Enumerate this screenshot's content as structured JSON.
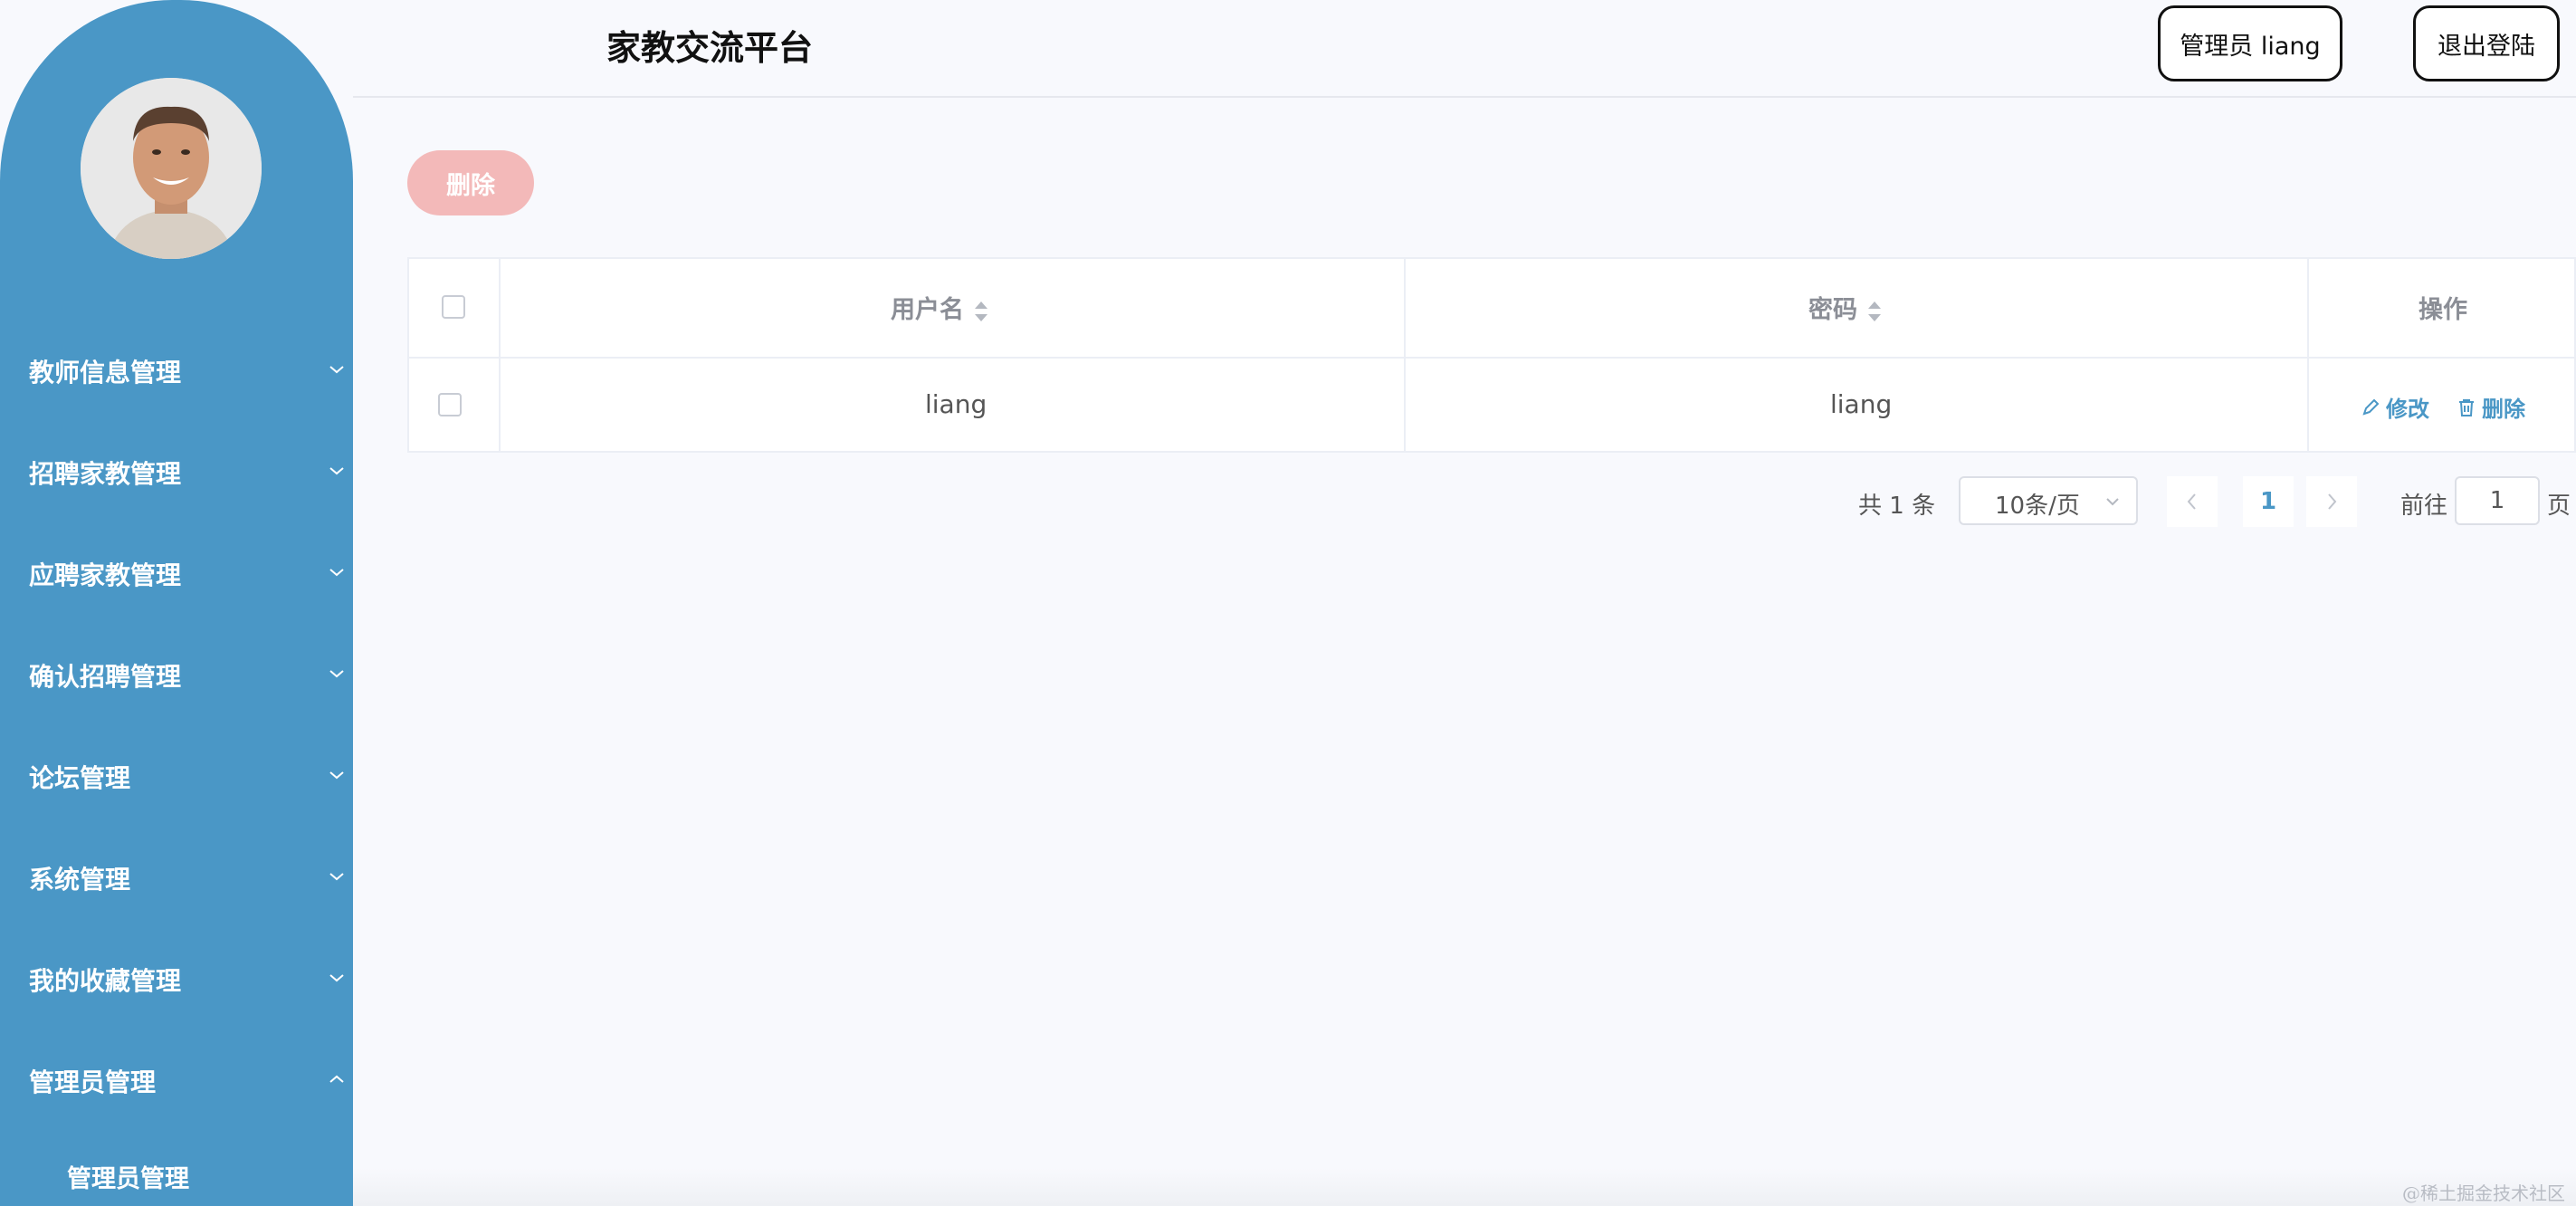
{
  "header": {
    "title": "家教交流平台",
    "admin_label": "管理员 liang",
    "logout_label": "退出登陆"
  },
  "sidebar": {
    "avatar": "avatar-photo",
    "items": [
      {
        "label": "教师信息管理",
        "expanded": false
      },
      {
        "label": "招聘家教管理",
        "expanded": false
      },
      {
        "label": "应聘家教管理",
        "expanded": false
      },
      {
        "label": "确认招聘管理",
        "expanded": false
      },
      {
        "label": "论坛管理",
        "expanded": false
      },
      {
        "label": "系统管理",
        "expanded": false
      },
      {
        "label": "我的收藏管理",
        "expanded": false
      },
      {
        "label": "管理员管理",
        "expanded": true
      }
    ],
    "subitems": [
      {
        "label": "管理员管理"
      }
    ]
  },
  "toolbar": {
    "delete_label": "删除"
  },
  "table": {
    "columns": [
      "用户名",
      "密码",
      "操作"
    ],
    "rows": [
      {
        "username": "liang",
        "password": "liang",
        "edit_label": "修改",
        "delete_label": "删除"
      }
    ]
  },
  "pagination": {
    "total": "共 1 条",
    "page_size": "10条/页",
    "current_page": "1",
    "goto_label": "前往",
    "goto_value": "1",
    "page_suffix": "页"
  },
  "watermark": "@稀土掘金技术社区",
  "colors": {
    "sidebar": "#4a97c6",
    "accent": "#4a97c6",
    "danger_light": "#f3b9b9",
    "background": "#f8f9fd"
  }
}
